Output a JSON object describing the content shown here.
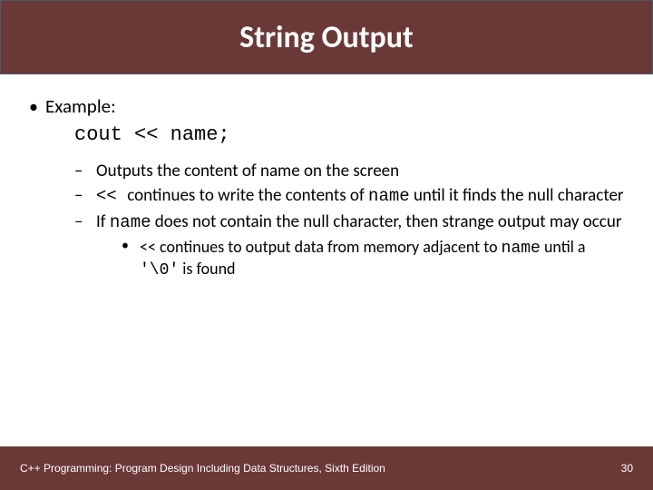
{
  "title": "String Output",
  "bullet1_label": "Example:",
  "code_line": "cout << name;",
  "dash1": "Outputs the content of name on the screen",
  "dash2_pre": "<< ",
  "dash2_mid": "continues to write the contents of ",
  "dash2_name": "name",
  "dash2_post": " until it finds the null character",
  "dash3_pre": "If ",
  "dash3_name": "name",
  "dash3_post": " does not contain the null character, then strange output may occur",
  "sub_pre": "<< continues to output data from memory adjacent to ",
  "sub_name": "name",
  "sub_mid": " until a ",
  "sub_code": "'\\0'",
  "sub_post": " is found",
  "footer_text": "C++ Programming: Program Design Including Data Structures, Sixth Edition",
  "page_number": "30"
}
